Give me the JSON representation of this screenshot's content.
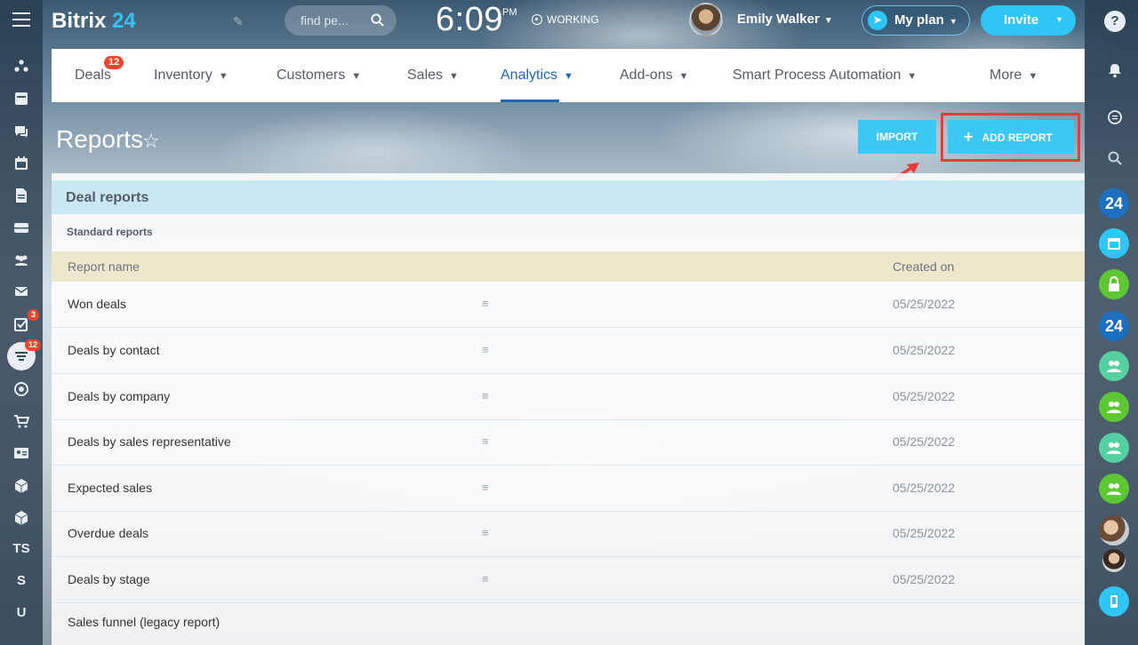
{
  "header": {
    "logo_name": "Bitrix",
    "logo_num": "24",
    "search_placeholder": "find pe...",
    "time": "6:09",
    "ampm": "PM",
    "work_status": "WORKING",
    "user_name": "Emily Walker",
    "myplan_label": "My plan",
    "invite_label": "Invite"
  },
  "left_sidebar": {
    "tasks_badge": "3",
    "crm_badge": "12",
    "text_items": [
      "TS",
      "S",
      "U"
    ]
  },
  "nav": {
    "items": [
      {
        "label": "Deals"
      },
      {
        "label": "Inventory"
      },
      {
        "label": "Customers"
      },
      {
        "label": "Sales"
      },
      {
        "label": "Analytics"
      },
      {
        "label": "Add-ons"
      },
      {
        "label": "Smart Process Automation"
      },
      {
        "label": "More"
      }
    ],
    "deals_badge": "12",
    "active": "Analytics"
  },
  "page": {
    "title": "Reports",
    "import_label": "IMPORT",
    "add_report_label": "ADD REPORT"
  },
  "right_sidebar": {
    "help_label": "?",
    "b24_label": "24"
  },
  "section": {
    "title": "Deal reports",
    "subsection": "Standard reports"
  },
  "table": {
    "columns": [
      "Report name",
      "Created on"
    ],
    "rows": [
      {
        "name": "Won deals",
        "date": "05/25/2022"
      },
      {
        "name": "Deals by contact",
        "date": "05/25/2022"
      },
      {
        "name": "Deals by company",
        "date": "05/25/2022"
      },
      {
        "name": "Deals by sales representative",
        "date": "05/25/2022"
      },
      {
        "name": "Expected sales",
        "date": "05/25/2022"
      },
      {
        "name": "Overdue deals",
        "date": "05/25/2022"
      },
      {
        "name": "Deals by stage",
        "date": "05/25/2022"
      },
      {
        "name": "Sales funnel (legacy report)",
        "date": ""
      }
    ]
  },
  "colors": {
    "accent": "#2fc6f6",
    "nav_active": "#2067b0",
    "badge": "#f0452c",
    "highlight": "#ea3b3b"
  }
}
